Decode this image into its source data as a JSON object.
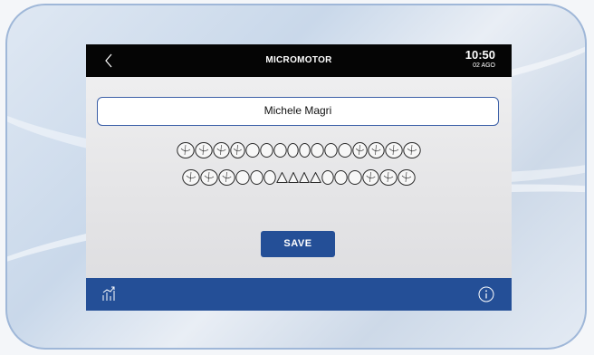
{
  "header": {
    "title": "MICROMOTOR",
    "time": "10:50",
    "date": "02 AGO"
  },
  "patient": {
    "name": "Michele Magri"
  },
  "dental_chart": {
    "upper_teeth_count": 16,
    "lower_teeth_count": 16,
    "selected_tooth": null
  },
  "actions": {
    "save_label": "SAVE"
  },
  "footer": {
    "left_icon": "stats-icon",
    "right_icon": "info-icon"
  },
  "colors": {
    "topbar": "#050505",
    "accent_blue": "#244f97",
    "field_border": "#3b5fa7"
  }
}
